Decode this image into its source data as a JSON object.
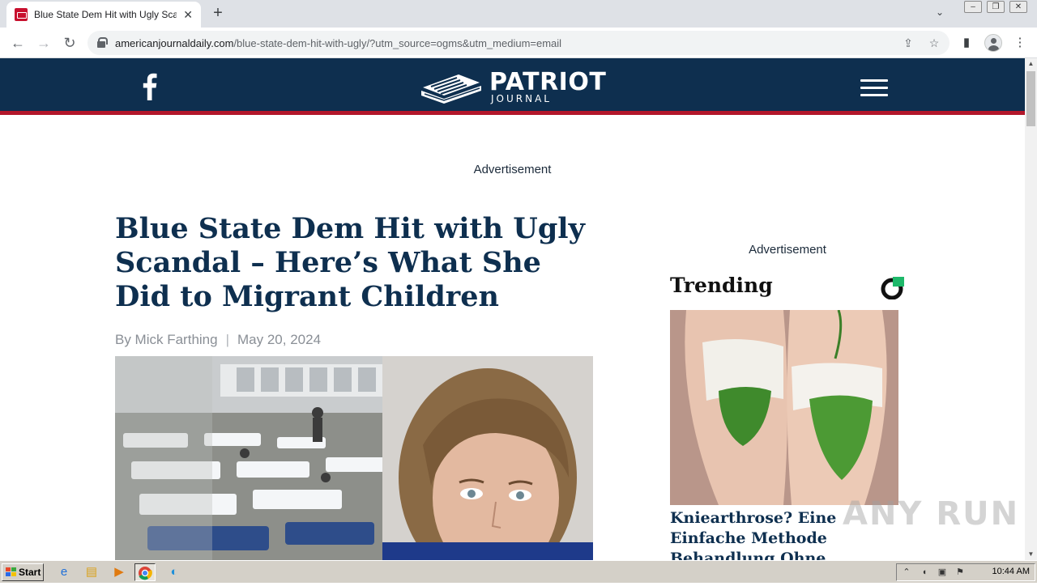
{
  "browser": {
    "tab_title": "Blue State Dem Hit with Ugly Scandal",
    "tab_close_icon": "close-icon",
    "new_tab_icon": "plus-icon",
    "url_domain": "americanjournaldaily.com",
    "url_path": "/blue-state-dem-hit-with-ugly/?utm_source=ogms&utm_medium=email"
  },
  "site": {
    "logo_main": "PATRIOT",
    "logo_sub": "JOURNAL",
    "header_color": "#0e2f4f",
    "accent_color": "#b3172b"
  },
  "page": {
    "ad_label_top": "Advertisement"
  },
  "article": {
    "title": "Blue State Dem Hit with Ugly Scandal – Here’s What She Did to Migrant Children",
    "author": "By Mick Farthing",
    "separator": "|",
    "date": "May 20, 2024"
  },
  "sidebar": {
    "ad_label": "Advertisement",
    "trending_title": "Trending",
    "trending_headline": "Kniearthrose? Eine Einfache Methode Behandlung Ohne Operation"
  },
  "watermark": "ANY RUN",
  "taskbar": {
    "start_label": "Start",
    "clock": "10:44 AM"
  }
}
